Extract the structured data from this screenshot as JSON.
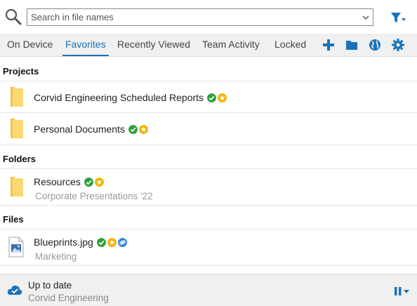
{
  "search": {
    "placeholder": "Search in file names"
  },
  "tabs": [
    {
      "label": "On Device",
      "active": false
    },
    {
      "label": "Favorites",
      "active": true
    },
    {
      "label": "Recently Viewed",
      "active": false
    },
    {
      "label": "Team Activity",
      "active": false
    },
    {
      "label": "Locked",
      "active": false
    }
  ],
  "toolbar_icons": [
    "plus-icon",
    "folder-icon",
    "globe-icon",
    "gear-icon"
  ],
  "sections": {
    "projects": {
      "label": "Projects",
      "items": [
        {
          "title": "Corvid Engineering Scheduled Reports",
          "badges": [
            "check",
            "star"
          ]
        },
        {
          "title": "Personal Documents",
          "badges": [
            "check",
            "star"
          ]
        }
      ]
    },
    "folders": {
      "label": "Folders",
      "items": [
        {
          "title": "Resources",
          "subtitle": "Corporate Presentations '22",
          "badges": [
            "check",
            "star"
          ]
        }
      ]
    },
    "files": {
      "label": "Files",
      "items": [
        {
          "title": "Blueprints.jpg",
          "subtitle": "Marketing",
          "badges": [
            "check",
            "star",
            "link"
          ]
        }
      ]
    }
  },
  "status": {
    "title": "Up to date",
    "subtitle": "Corvid Engineering"
  },
  "colors": {
    "accent": "#1a73b8",
    "check": "#2e9e3e",
    "star": "#f0b400",
    "link": "#2f86d6",
    "folder": "#f6c343",
    "folder_light": "#fbd972"
  }
}
